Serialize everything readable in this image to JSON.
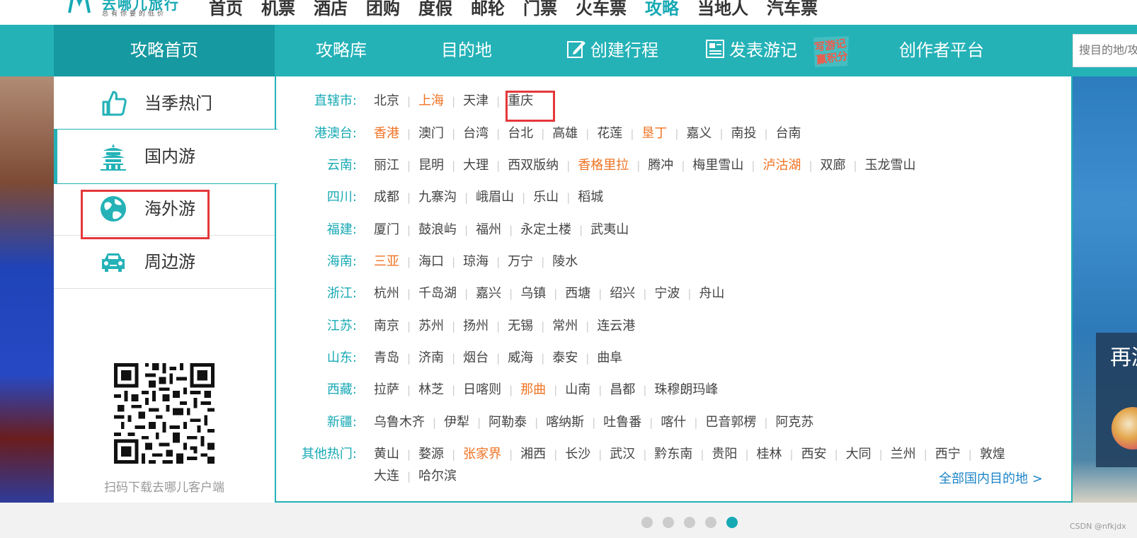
{
  "brand": {
    "name": "去哪儿旅行",
    "slogan": "总有你要的低价"
  },
  "top_nav": [
    "首页",
    "机票",
    "酒店",
    "团购",
    "度假",
    "邮轮",
    "门票",
    "火车票",
    "攻略",
    "当地人",
    "汽车票"
  ],
  "top_nav_active": "攻略",
  "sub_nav": {
    "home": "攻略首页",
    "library": "攻略库",
    "destination": "目的地",
    "create_trip": "创建行程",
    "publish_notes": "发表游记",
    "write_badge": "写游记赢积分",
    "creator": "创作者平台",
    "search_placeholder": "搜目的地/攻"
  },
  "categories": [
    "当季热门",
    "国内游",
    "海外游",
    "周边游"
  ],
  "qr_caption": "扫码下载去哪儿客户端",
  "regions": [
    {
      "label": "直辖市:",
      "cities": [
        [
          "北京",
          false
        ],
        [
          "上海",
          true
        ],
        [
          "天津",
          false
        ],
        [
          "重庆",
          false
        ]
      ]
    },
    {
      "label": "港澳台:",
      "cities": [
        [
          "香港",
          true
        ],
        [
          "澳门",
          false
        ],
        [
          "台湾",
          false
        ],
        [
          "台北",
          false
        ],
        [
          "高雄",
          false
        ],
        [
          "花莲",
          false
        ],
        [
          "垦丁",
          true
        ],
        [
          "嘉义",
          false
        ],
        [
          "南投",
          false
        ],
        [
          "台南",
          false
        ]
      ]
    },
    {
      "label": "云南:",
      "cities": [
        [
          "丽江",
          false
        ],
        [
          "昆明",
          false
        ],
        [
          "大理",
          false
        ],
        [
          "西双版纳",
          false
        ],
        [
          "香格里拉",
          true
        ],
        [
          "腾冲",
          false
        ],
        [
          "梅里雪山",
          false
        ],
        [
          "泸沽湖",
          true
        ],
        [
          "双廊",
          false
        ],
        [
          "玉龙雪山",
          false
        ]
      ]
    },
    {
      "label": "四川:",
      "cities": [
        [
          "成都",
          false
        ],
        [
          "九寨沟",
          false
        ],
        [
          "峨眉山",
          false
        ],
        [
          "乐山",
          false
        ],
        [
          "稻城",
          false
        ]
      ]
    },
    {
      "label": "福建:",
      "cities": [
        [
          "厦门",
          false
        ],
        [
          "鼓浪屿",
          false
        ],
        [
          "福州",
          false
        ],
        [
          "永定土楼",
          false
        ],
        [
          "武夷山",
          false
        ]
      ]
    },
    {
      "label": "海南:",
      "cities": [
        [
          "三亚",
          true
        ],
        [
          "海口",
          false
        ],
        [
          "琼海",
          false
        ],
        [
          "万宁",
          false
        ],
        [
          "陵水",
          false
        ]
      ]
    },
    {
      "label": "浙江:",
      "cities": [
        [
          "杭州",
          false
        ],
        [
          "千岛湖",
          false
        ],
        [
          "嘉兴",
          false
        ],
        [
          "乌镇",
          false
        ],
        [
          "西塘",
          false
        ],
        [
          "绍兴",
          false
        ],
        [
          "宁波",
          false
        ],
        [
          "舟山",
          false
        ]
      ]
    },
    {
      "label": "江苏:",
      "cities": [
        [
          "南京",
          false
        ],
        [
          "苏州",
          false
        ],
        [
          "扬州",
          false
        ],
        [
          "无锡",
          false
        ],
        [
          "常州",
          false
        ],
        [
          "连云港",
          false
        ]
      ]
    },
    {
      "label": "山东:",
      "cities": [
        [
          "青岛",
          false
        ],
        [
          "济南",
          false
        ],
        [
          "烟台",
          false
        ],
        [
          "威海",
          false
        ],
        [
          "泰安",
          false
        ],
        [
          "曲阜",
          false
        ]
      ]
    },
    {
      "label": "西藏:",
      "cities": [
        [
          "拉萨",
          false
        ],
        [
          "林芝",
          false
        ],
        [
          "日喀则",
          false
        ],
        [
          "那曲",
          true
        ],
        [
          "山南",
          false
        ],
        [
          "昌都",
          false
        ],
        [
          "珠穆朗玛峰",
          false
        ]
      ]
    },
    {
      "label": "新疆:",
      "cities": [
        [
          "乌鲁木齐",
          false
        ],
        [
          "伊犁",
          false
        ],
        [
          "阿勒泰",
          false
        ],
        [
          "喀纳斯",
          false
        ],
        [
          "吐鲁番",
          false
        ],
        [
          "喀什",
          false
        ],
        [
          "巴音郭楞",
          false
        ],
        [
          "阿克苏",
          false
        ]
      ]
    },
    {
      "label": "其他热门:",
      "cities": [
        [
          "黄山",
          false
        ],
        [
          "婺源",
          false
        ],
        [
          "张家界",
          true
        ],
        [
          "湘西",
          false
        ],
        [
          "长沙",
          false
        ],
        [
          "武汉",
          false
        ],
        [
          "黔东南",
          false
        ],
        [
          "贵阳",
          false
        ],
        [
          "桂林",
          false
        ],
        [
          "西安",
          false
        ],
        [
          "大同",
          false
        ],
        [
          "兰州",
          false
        ],
        [
          "西宁",
          false
        ],
        [
          "敦煌",
          false
        ]
      ]
    },
    {
      "label": "",
      "cities": [
        [
          "大连",
          false
        ],
        [
          "哈尔滨",
          false
        ]
      ]
    }
  ],
  "all_domestic_link": "全部国内目的地 >",
  "promo_text": "再游阿里",
  "carousel_active_index": 4,
  "carousel_count": 5,
  "credit": "CSDN @nfkjdx",
  "colors": {
    "accent": "#24b2b7",
    "accent_dark": "#1699a0",
    "hot": "#f07323",
    "highlight": "#e5383b"
  }
}
